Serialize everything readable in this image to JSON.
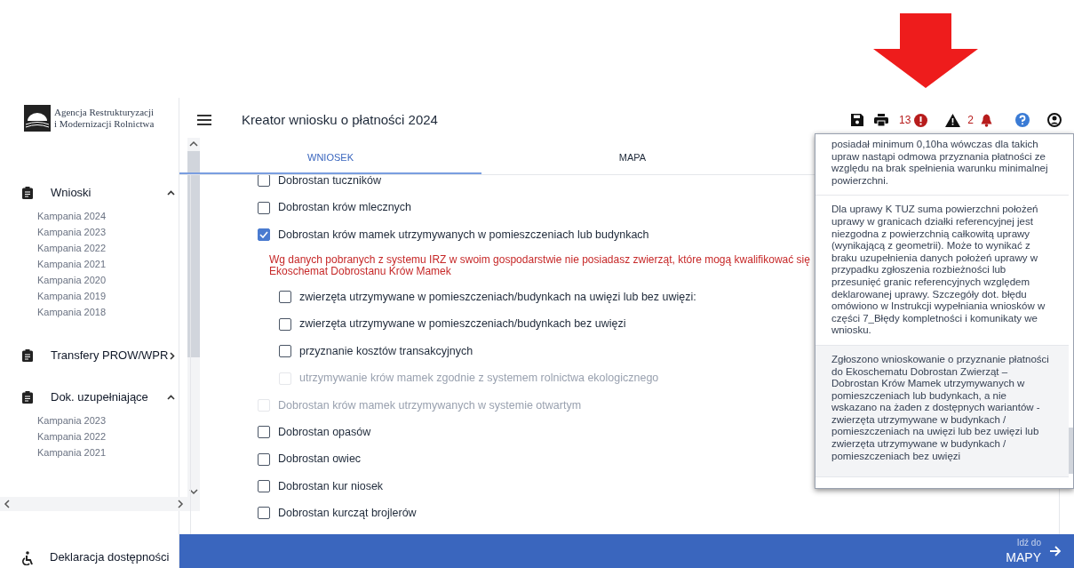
{
  "logo": {
    "lines": [
      "Agencja Restrukturyzacji",
      "i Modernizacji Rolnictwa"
    ]
  },
  "sidebar": {
    "items": [
      {
        "label": "Wnioski",
        "expanded": true,
        "children": [
          {
            "label": "Kampania 2024"
          },
          {
            "label": "Kampania 2023"
          },
          {
            "label": "Kampania 2022"
          },
          {
            "label": "Kampania 2021"
          },
          {
            "label": "Kampania 2020"
          },
          {
            "label": "Kampania 2019"
          },
          {
            "label": "Kampania 2018"
          }
        ]
      },
      {
        "label": "Transfery PROW/WPR",
        "expanded": false
      },
      {
        "label": "Dok. uzupełniające",
        "expanded": true,
        "children": [
          {
            "label": "Kampania 2023"
          },
          {
            "label": "Kampania 2022"
          },
          {
            "label": "Kampania 2021"
          }
        ]
      }
    ],
    "footer": "Deklaracja dostępności"
  },
  "header": {
    "title": "Kreator wniosku o płatności 2024",
    "error_count": "13",
    "warning_count": "2"
  },
  "tabs": [
    {
      "label": "WNIOSEK",
      "selected": true
    },
    {
      "label": "MAPA",
      "selected": false
    }
  ],
  "options": [
    {
      "kind": "checkbox",
      "label": "Dobrostan tuczników",
      "checked": false,
      "disabled": false
    },
    {
      "kind": "checkbox",
      "label": "Dobrostan krów mlecznych",
      "checked": false,
      "disabled": false
    },
    {
      "kind": "checkbox",
      "label": "Dobrostan krów mamek utrzymywanych w pomieszczeniach lub budynkach",
      "checked": true,
      "disabled": false,
      "children": [
        {
          "kind": "notice",
          "lines": [
            "Wg danych pobranych z systemu IRZ w swoim gospodarstwie nie posiadasz zwierząt, które mogą kwalifikować się",
            "Ekoschemat Dobrostanu Krów Mamek"
          ]
        },
        {
          "kind": "checkbox",
          "label": "zwierzęta utrzymywane w pomieszczeniach/budynkach na uwięzi lub bez uwięzi:",
          "checked": false,
          "disabled": false
        },
        {
          "kind": "checkbox",
          "label": "zwierzęta utrzymywane w pomieszczeniach/budynkach bez uwięzi",
          "checked": false,
          "disabled": false
        },
        {
          "kind": "checkbox",
          "label": "przyznanie kosztów transakcyjnych",
          "checked": false,
          "disabled": false
        },
        {
          "kind": "checkbox",
          "label": "utrzymywanie krów mamek zgodnie z systemem rolnictwa ekologicznego",
          "checked": false,
          "disabled": true
        }
      ]
    },
    {
      "kind": "checkbox",
      "label": "Dobrostan krów mamek utrzymywanych w systemie otwartym",
      "checked": false,
      "disabled": true
    },
    {
      "kind": "checkbox",
      "label": "Dobrostan opasów",
      "checked": false,
      "disabled": false
    },
    {
      "kind": "checkbox",
      "label": "Dobrostan owiec",
      "checked": false,
      "disabled": false
    },
    {
      "kind": "checkbox",
      "label": "Dobrostan kur niosek",
      "checked": false,
      "disabled": false
    },
    {
      "kind": "checkbox",
      "label": "Dobrostan kurcząt brojlerów",
      "checked": false,
      "disabled": false
    }
  ],
  "messages": [
    {
      "text": "posiadał minimum 0,10ha wówczas dla takich upraw nastąpi odmowa przyznania płatności ze względu na brak spełnienia warunku minimalnej powierzchni.",
      "selected": false
    },
    {
      "text": "Dla uprawy K TUZ suma powierzchni położeń uprawy w granicach działki referencyjnej jest niezgodna z powierzchnią całkowitą uprawy (wynikającą z geometrii). Może to wynikać z braku uzupełnienia danych położeń uprawy w przypadku zgłoszenia rozbieżności lub przesunięć granic referencyjnych względem deklarowanej uprawy. Szczegóły dot. błędu omówiono w Instrukcji wypełniania wniosków w części 7_Błędy kompletności i komunikaty we wniosku.",
      "selected": false
    },
    {
      "text": "Zgłoszono wnioskowanie o przyznanie płatności do Ekoschematu Dobrostan Zwierząt – Dobrostan Krów Mamek utrzymywanych w pomieszczeniach lub budynkach, a nie wskazano na żaden z dostępnych wariantów - zwierzęta utrzymywane w budynkach / pomieszczeniach na uwięzi lub bez uwięzi lub zwierzęta utrzymywane w budynkach / pomieszczeniach bez uwięzi",
      "selected": true
    }
  ],
  "footer_button": {
    "caption": "Idź do",
    "label": "MAPY"
  }
}
